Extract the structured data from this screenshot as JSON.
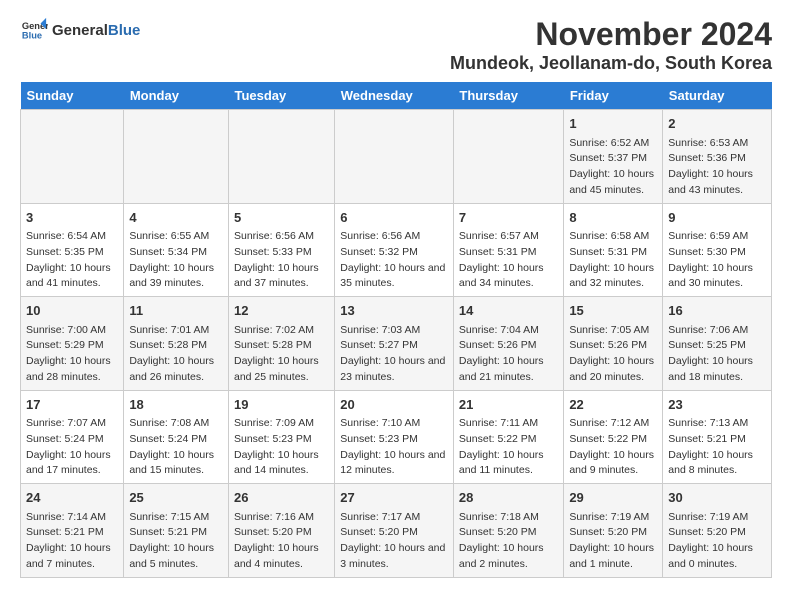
{
  "logo": {
    "general": "General",
    "blue": "Blue"
  },
  "title": "November 2024",
  "subtitle": "Mundeok, Jeollanam-do, South Korea",
  "days_of_week": [
    "Sunday",
    "Monday",
    "Tuesday",
    "Wednesday",
    "Thursday",
    "Friday",
    "Saturday"
  ],
  "weeks": [
    [
      {
        "day": "",
        "content": ""
      },
      {
        "day": "",
        "content": ""
      },
      {
        "day": "",
        "content": ""
      },
      {
        "day": "",
        "content": ""
      },
      {
        "day": "",
        "content": ""
      },
      {
        "day": "1",
        "content": "Sunrise: 6:52 AM\nSunset: 5:37 PM\nDaylight: 10 hours and 45 minutes."
      },
      {
        "day": "2",
        "content": "Sunrise: 6:53 AM\nSunset: 5:36 PM\nDaylight: 10 hours and 43 minutes."
      }
    ],
    [
      {
        "day": "3",
        "content": "Sunrise: 6:54 AM\nSunset: 5:35 PM\nDaylight: 10 hours and 41 minutes."
      },
      {
        "day": "4",
        "content": "Sunrise: 6:55 AM\nSunset: 5:34 PM\nDaylight: 10 hours and 39 minutes."
      },
      {
        "day": "5",
        "content": "Sunrise: 6:56 AM\nSunset: 5:33 PM\nDaylight: 10 hours and 37 minutes."
      },
      {
        "day": "6",
        "content": "Sunrise: 6:56 AM\nSunset: 5:32 PM\nDaylight: 10 hours and 35 minutes."
      },
      {
        "day": "7",
        "content": "Sunrise: 6:57 AM\nSunset: 5:31 PM\nDaylight: 10 hours and 34 minutes."
      },
      {
        "day": "8",
        "content": "Sunrise: 6:58 AM\nSunset: 5:31 PM\nDaylight: 10 hours and 32 minutes."
      },
      {
        "day": "9",
        "content": "Sunrise: 6:59 AM\nSunset: 5:30 PM\nDaylight: 10 hours and 30 minutes."
      }
    ],
    [
      {
        "day": "10",
        "content": "Sunrise: 7:00 AM\nSunset: 5:29 PM\nDaylight: 10 hours and 28 minutes."
      },
      {
        "day": "11",
        "content": "Sunrise: 7:01 AM\nSunset: 5:28 PM\nDaylight: 10 hours and 26 minutes."
      },
      {
        "day": "12",
        "content": "Sunrise: 7:02 AM\nSunset: 5:28 PM\nDaylight: 10 hours and 25 minutes."
      },
      {
        "day": "13",
        "content": "Sunrise: 7:03 AM\nSunset: 5:27 PM\nDaylight: 10 hours and 23 minutes."
      },
      {
        "day": "14",
        "content": "Sunrise: 7:04 AM\nSunset: 5:26 PM\nDaylight: 10 hours and 21 minutes."
      },
      {
        "day": "15",
        "content": "Sunrise: 7:05 AM\nSunset: 5:26 PM\nDaylight: 10 hours and 20 minutes."
      },
      {
        "day": "16",
        "content": "Sunrise: 7:06 AM\nSunset: 5:25 PM\nDaylight: 10 hours and 18 minutes."
      }
    ],
    [
      {
        "day": "17",
        "content": "Sunrise: 7:07 AM\nSunset: 5:24 PM\nDaylight: 10 hours and 17 minutes."
      },
      {
        "day": "18",
        "content": "Sunrise: 7:08 AM\nSunset: 5:24 PM\nDaylight: 10 hours and 15 minutes."
      },
      {
        "day": "19",
        "content": "Sunrise: 7:09 AM\nSunset: 5:23 PM\nDaylight: 10 hours and 14 minutes."
      },
      {
        "day": "20",
        "content": "Sunrise: 7:10 AM\nSunset: 5:23 PM\nDaylight: 10 hours and 12 minutes."
      },
      {
        "day": "21",
        "content": "Sunrise: 7:11 AM\nSunset: 5:22 PM\nDaylight: 10 hours and 11 minutes."
      },
      {
        "day": "22",
        "content": "Sunrise: 7:12 AM\nSunset: 5:22 PM\nDaylight: 10 hours and 9 minutes."
      },
      {
        "day": "23",
        "content": "Sunrise: 7:13 AM\nSunset: 5:21 PM\nDaylight: 10 hours and 8 minutes."
      }
    ],
    [
      {
        "day": "24",
        "content": "Sunrise: 7:14 AM\nSunset: 5:21 PM\nDaylight: 10 hours and 7 minutes."
      },
      {
        "day": "25",
        "content": "Sunrise: 7:15 AM\nSunset: 5:21 PM\nDaylight: 10 hours and 5 minutes."
      },
      {
        "day": "26",
        "content": "Sunrise: 7:16 AM\nSunset: 5:20 PM\nDaylight: 10 hours and 4 minutes."
      },
      {
        "day": "27",
        "content": "Sunrise: 7:17 AM\nSunset: 5:20 PM\nDaylight: 10 hours and 3 minutes."
      },
      {
        "day": "28",
        "content": "Sunrise: 7:18 AM\nSunset: 5:20 PM\nDaylight: 10 hours and 2 minutes."
      },
      {
        "day": "29",
        "content": "Sunrise: 7:19 AM\nSunset: 5:20 PM\nDaylight: 10 hours and 1 minute."
      },
      {
        "day": "30",
        "content": "Sunrise: 7:19 AM\nSunset: 5:20 PM\nDaylight: 10 hours and 0 minutes."
      }
    ]
  ]
}
